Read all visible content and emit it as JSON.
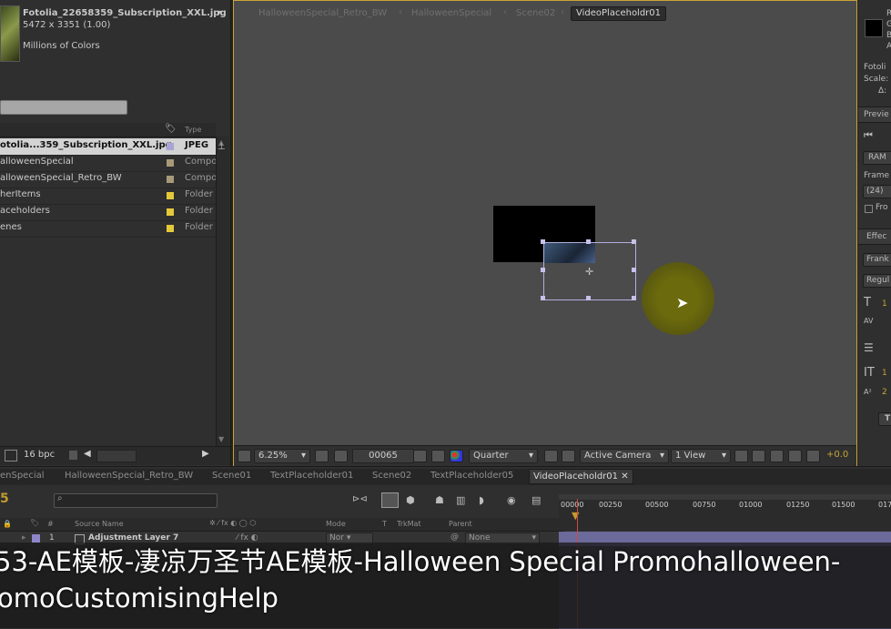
{
  "project": {
    "file_name": "Fotolia_22658359_Subscription_XXL.jpg",
    "dimensions": "5472 x 3351 (1.00)",
    "colors": "Millions of Colors",
    "type_header": "Type",
    "items": [
      {
        "name": "otolia...359_Subscription_XXL.jpg",
        "type": "JPEG",
        "swatch": "#a9a4d4",
        "selected": true
      },
      {
        "name": "alloweenSpecial",
        "type": "Compo",
        "swatch": "#a89a78",
        "selected": false
      },
      {
        "name": "alloweenSpecial_Retro_BW",
        "type": "Compo",
        "swatch": "#a89a78",
        "selected": false
      },
      {
        "name": "herItems",
        "type": "Folder",
        "swatch": "#e3c93a",
        "selected": false
      },
      {
        "name": "aceholders",
        "type": "Folder",
        "swatch": "#e3c93a",
        "selected": false
      },
      {
        "name": "enes",
        "type": "Folder",
        "swatch": "#e3c93a",
        "selected": false
      }
    ],
    "bpc": "16 bpc"
  },
  "viewer": {
    "breadcrumbs": [
      "HalloweenSpecial_Retro_BW",
      "HalloweenSpecial",
      "Scene02"
    ],
    "active_crumb": "VideoPlaceholdr01",
    "zoom": "6.25%",
    "frame": "00065",
    "resolution": "Quarter",
    "camera": "Active Camera",
    "views": "1 View",
    "exposure": "+0.0"
  },
  "right_panel": {
    "info_lines": [
      "R",
      "G",
      "B",
      "A"
    ],
    "file_label": "Fotoli",
    "scale_label": "Scale:",
    "delta_label": "Δ:",
    "preview_title": "Previe",
    "ram_label": "RAM",
    "frame_label": "Frame",
    "frame_rate": "(24)",
    "from_label": "Fro",
    "effects_title": "Effec",
    "font_name": "Frank",
    "font_style": "Regul",
    "size_value": "1",
    "leading_value": "1",
    "baseline_value": "2",
    "t_label": "T"
  },
  "timeline": {
    "tabs": [
      "enSpecial",
      "HalloweenSpecial_Retro_BW",
      "Scene01",
      "TextPlaceholder01",
      "Scene02",
      "TextPlaceholder05"
    ],
    "active_tab": "VideoPlaceholdr01",
    "timecode": "5",
    "ruler": [
      "00000",
      "00250",
      "00500",
      "00750",
      "01000",
      "01250",
      "01500",
      "017"
    ],
    "col_source": "Source Name",
    "col_mode": "Mode",
    "col_t": "T",
    "col_trkmat": "TrkMat",
    "col_parent": "Parent",
    "layer_index": "1",
    "layer_name": "Adjustment Layer 7",
    "layer_mode": "Nor",
    "layer_parent": "None"
  },
  "subtitles": {
    "line1": "53-AE模板-凄凉万圣节AE模板-Halloween Special Promohalloween-",
    "line2": "omoCustomisingHelp"
  },
  "colors": {
    "accent": "#caa23a",
    "timecode": "#c29a2e",
    "playhead": "#d14848"
  }
}
